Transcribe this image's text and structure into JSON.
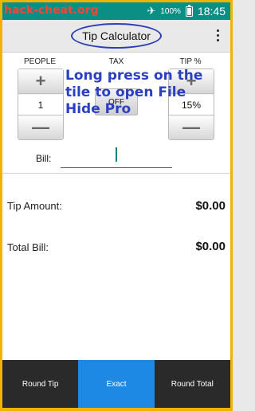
{
  "status_bar": {
    "watermark": "hack-cheat.org",
    "battery": "100%",
    "time": "18:45",
    "icons": [
      "airplane-mode-icon",
      "battery-icon"
    ]
  },
  "app_bar": {
    "title": "Tip Calculator",
    "menu_icon": "overflow-menu-icon"
  },
  "steppers": {
    "people": {
      "label": "PEOPLE",
      "value": "1",
      "plus": "+",
      "minus": "—"
    },
    "tax": {
      "label": "TAX",
      "value": "OFF"
    },
    "tip": {
      "label": "TIP %",
      "value": "15%",
      "plus": "+",
      "minus": "—"
    }
  },
  "overlay": {
    "text": "Long press on the tile to open File Hide Pro"
  },
  "bill": {
    "label": "Bill:",
    "value": ""
  },
  "results": {
    "tip_amount": {
      "label": "Tip Amount:",
      "value": "$0.00"
    },
    "total_bill": {
      "label": "Total Bill:",
      "value": "$0.00"
    }
  },
  "bottom_tabs": [
    {
      "label": "Round Tip",
      "active": false
    },
    {
      "label": "Exact",
      "active": true
    },
    {
      "label": "Round Total",
      "active": false
    }
  ],
  "colors": {
    "status_bar": "#0b8f85",
    "accent": "#10857b",
    "active_tab": "#1e88e5",
    "overlay_text": "#2b3fc2",
    "frame": "#f0b400"
  }
}
